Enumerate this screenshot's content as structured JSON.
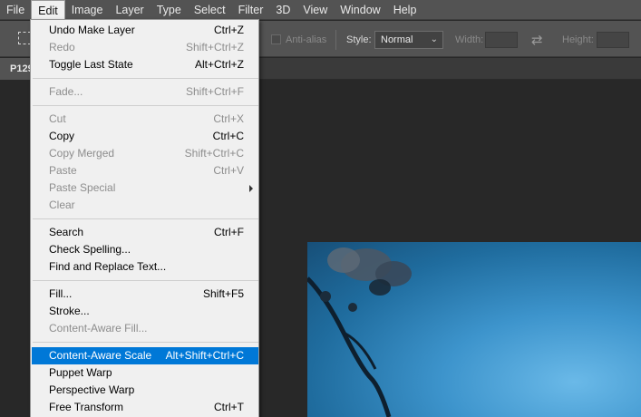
{
  "menubar": {
    "items": [
      {
        "label": "File"
      },
      {
        "label": "Edit"
      },
      {
        "label": "Image"
      },
      {
        "label": "Layer"
      },
      {
        "label": "Type"
      },
      {
        "label": "Select"
      },
      {
        "label": "Filter"
      },
      {
        "label": "3D"
      },
      {
        "label": "View"
      },
      {
        "label": "Window"
      },
      {
        "label": "Help"
      }
    ]
  },
  "options": {
    "antialias_label": "Anti-alias",
    "style_label": "Style:",
    "style_value": "Normal",
    "width_label": "Width:",
    "height_label": "Height:"
  },
  "document": {
    "tab_label": "P129"
  },
  "edit_menu": {
    "items": [
      {
        "label": "Undo Make Layer",
        "shortcut": "Ctrl+Z"
      },
      {
        "label": "Redo",
        "shortcut": "Shift+Ctrl+Z"
      },
      {
        "label": "Toggle Last State",
        "shortcut": "Alt+Ctrl+Z"
      },
      {
        "label": "Fade...",
        "shortcut": "Shift+Ctrl+F"
      },
      {
        "label": "Cut",
        "shortcut": "Ctrl+X"
      },
      {
        "label": "Copy",
        "shortcut": "Ctrl+C"
      },
      {
        "label": "Copy Merged",
        "shortcut": "Shift+Ctrl+C"
      },
      {
        "label": "Paste",
        "shortcut": "Ctrl+V"
      },
      {
        "label": "Paste Special",
        "shortcut": ""
      },
      {
        "label": "Clear",
        "shortcut": ""
      },
      {
        "label": "Search",
        "shortcut": "Ctrl+F"
      },
      {
        "label": "Check Spelling...",
        "shortcut": ""
      },
      {
        "label": "Find and Replace Text...",
        "shortcut": ""
      },
      {
        "label": "Fill...",
        "shortcut": "Shift+F5"
      },
      {
        "label": "Stroke...",
        "shortcut": ""
      },
      {
        "label": "Content-Aware Fill...",
        "shortcut": ""
      },
      {
        "label": "Content-Aware Scale",
        "shortcut": "Alt+Shift+Ctrl+C"
      },
      {
        "label": "Puppet Warp",
        "shortcut": ""
      },
      {
        "label": "Perspective Warp",
        "shortcut": ""
      },
      {
        "label": "Free Transform",
        "shortcut": "Ctrl+T"
      }
    ]
  },
  "colors": {
    "menu_highlight": "#0078d7",
    "disabled_text": "#8d8d8d",
    "menubar_bg": "#535353",
    "canvas_bg": "#282828"
  }
}
